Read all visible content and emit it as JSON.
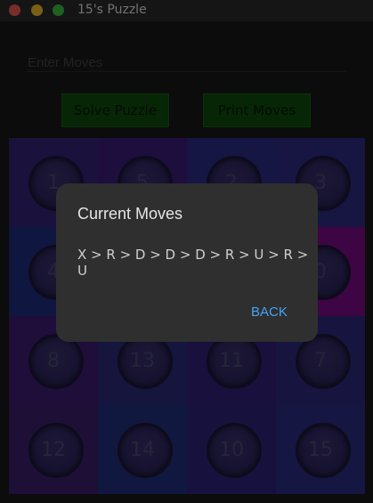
{
  "window": {
    "title": "15's Puzzle"
  },
  "moves_input": {
    "placeholder": "Enter Moves"
  },
  "buttons": {
    "solve": "Solve Puzzle",
    "print": "Print Moves"
  },
  "tiles": [
    {
      "value": "1",
      "bg": "#34237a"
    },
    {
      "value": "5",
      "bg": "#3a1d7a"
    },
    {
      "value": "2",
      "bg": "#2a2c86"
    },
    {
      "value": "3",
      "bg": "#2e2a82"
    },
    {
      "value": "4",
      "bg": "#1f2e80"
    },
    {
      "value": "",
      "bg": "#2c1f73"
    },
    {
      "value": "",
      "bg": "#4a1e78"
    },
    {
      "value": "0",
      "bg": "#7a0a86"
    },
    {
      "value": "8",
      "bg": "#3f1a74"
    },
    {
      "value": "13",
      "bg": "#2a2a7a"
    },
    {
      "value": "11",
      "bg": "#35217a"
    },
    {
      "value": "7",
      "bg": "#2f2a7e"
    },
    {
      "value": "12",
      "bg": "#3a1e6c"
    },
    {
      "value": "14",
      "bg": "#22307e"
    },
    {
      "value": "10",
      "bg": "#2f257b"
    },
    {
      "value": "15",
      "bg": "#2b2d83"
    }
  ],
  "dialog": {
    "title": "Current Moves",
    "moves": "X > R > D > D > D > R > U > R > U",
    "back": "BACK"
  }
}
